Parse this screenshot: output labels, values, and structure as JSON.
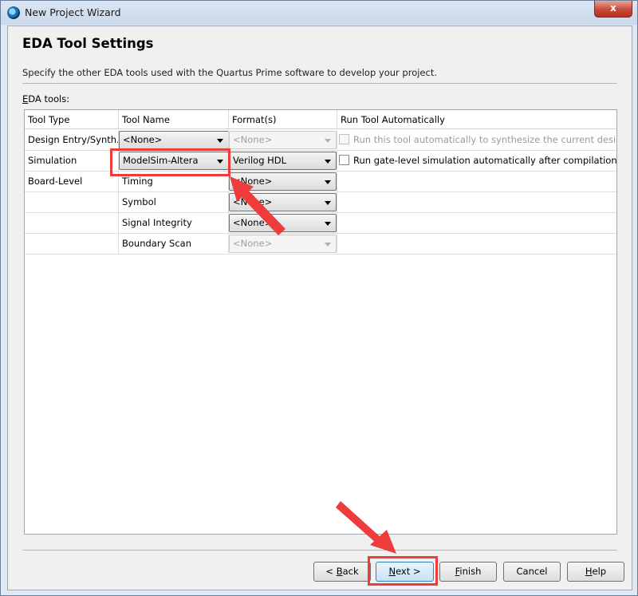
{
  "window": {
    "title": "New Project Wizard",
    "close_label": "x"
  },
  "page": {
    "title": "EDA Tool Settings",
    "subtitle": "Specify the other EDA tools used with the Quartus Prime software to develop your project.",
    "eda_tools_label_accel": "E",
    "eda_tools_label_rest": "DA tools:"
  },
  "table": {
    "headers": [
      "Tool Type",
      "Tool Name",
      "Format(s)",
      "Run Tool Automatically"
    ],
    "rows": [
      {
        "tool_type": "Design Entry/Synth...",
        "tool_name": "<None>",
        "format": "<None>",
        "run_auto": "Run this tool automatically to synthesize the current design"
      },
      {
        "tool_type": "Simulation",
        "tool_name": "ModelSim-Altera",
        "format": "Verilog HDL",
        "run_auto": "Run gate-level simulation automatically after compilation"
      },
      {
        "tool_type": "Board-Level",
        "tool_name": "Timing",
        "format": "<None>"
      },
      {
        "tool_type": "",
        "tool_name": "Symbol",
        "format": "<None>"
      },
      {
        "tool_type": "",
        "tool_name": "Signal Integrity",
        "format": "<None>"
      },
      {
        "tool_type": "",
        "tool_name": "Boundary Scan",
        "format": "<None>"
      }
    ]
  },
  "buttons": {
    "back_prefix": "< ",
    "back_accel": "B",
    "back_rest": "ack",
    "next_accel": "N",
    "next_rest": "ext >",
    "finish_accel": "F",
    "finish_rest": "inish",
    "cancel": "Cancel",
    "help_accel": "H",
    "help_rest": "elp"
  },
  "colors": {
    "highlight": "#ee3b3b",
    "accent": "#3c7fb1"
  }
}
